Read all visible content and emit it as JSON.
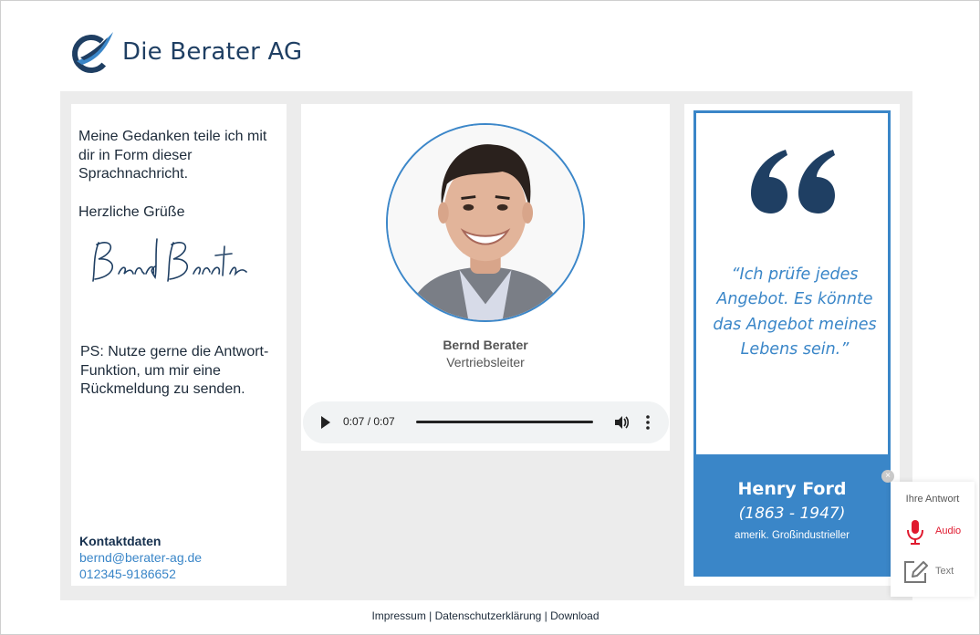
{
  "header": {
    "brand_name": "Die Berater AG"
  },
  "left": {
    "intro_text": "Meine Gedanken teile ich mit dir in Form dieser Sprachnachricht.",
    "greeting": "Herzliche Grüße",
    "signature": "Bernd Berater",
    "ps_text": "PS: Nutze gerne die Antwort-Funktion, um mir eine Rückmeldung zu senden.",
    "contact_title": "Kontaktdaten",
    "email": "bernd@berater-ag.de",
    "phone": "012345-9186652"
  },
  "middle": {
    "name": "Bernd Berater",
    "role": "Vertriebsleiter",
    "audio": {
      "time": "0:07 / 0:07",
      "progress": 1.0
    }
  },
  "quote": {
    "text": "“Ich prüfe jedes Angebot. Es könnte das Angebot meines Lebens sein.”",
    "author": "Henry Ford",
    "years": "(1863 - 1947)",
    "description": "amerik. Großindustrieller"
  },
  "reply_widget": {
    "title": "Ihre Antwort",
    "audio_label": "Audio",
    "text_label": "Text",
    "close_symbol": "×"
  },
  "footer": {
    "links": [
      "Impressum",
      "Datenschutzerklärung",
      "Download"
    ],
    "separator": " | "
  },
  "colors": {
    "brand_dark": "#1f3f63",
    "accent_blue": "#3a86c8",
    "record_red": "#e0192e",
    "panel_gray": "#ececec"
  },
  "icons": {
    "logo": "swoosh-logo-icon",
    "play": "play-icon",
    "volume": "volume-icon",
    "menu": "more-vertical-icon",
    "quote": "quote-mark-icon",
    "mic": "microphone-icon",
    "edit": "edit-pencil-icon"
  }
}
